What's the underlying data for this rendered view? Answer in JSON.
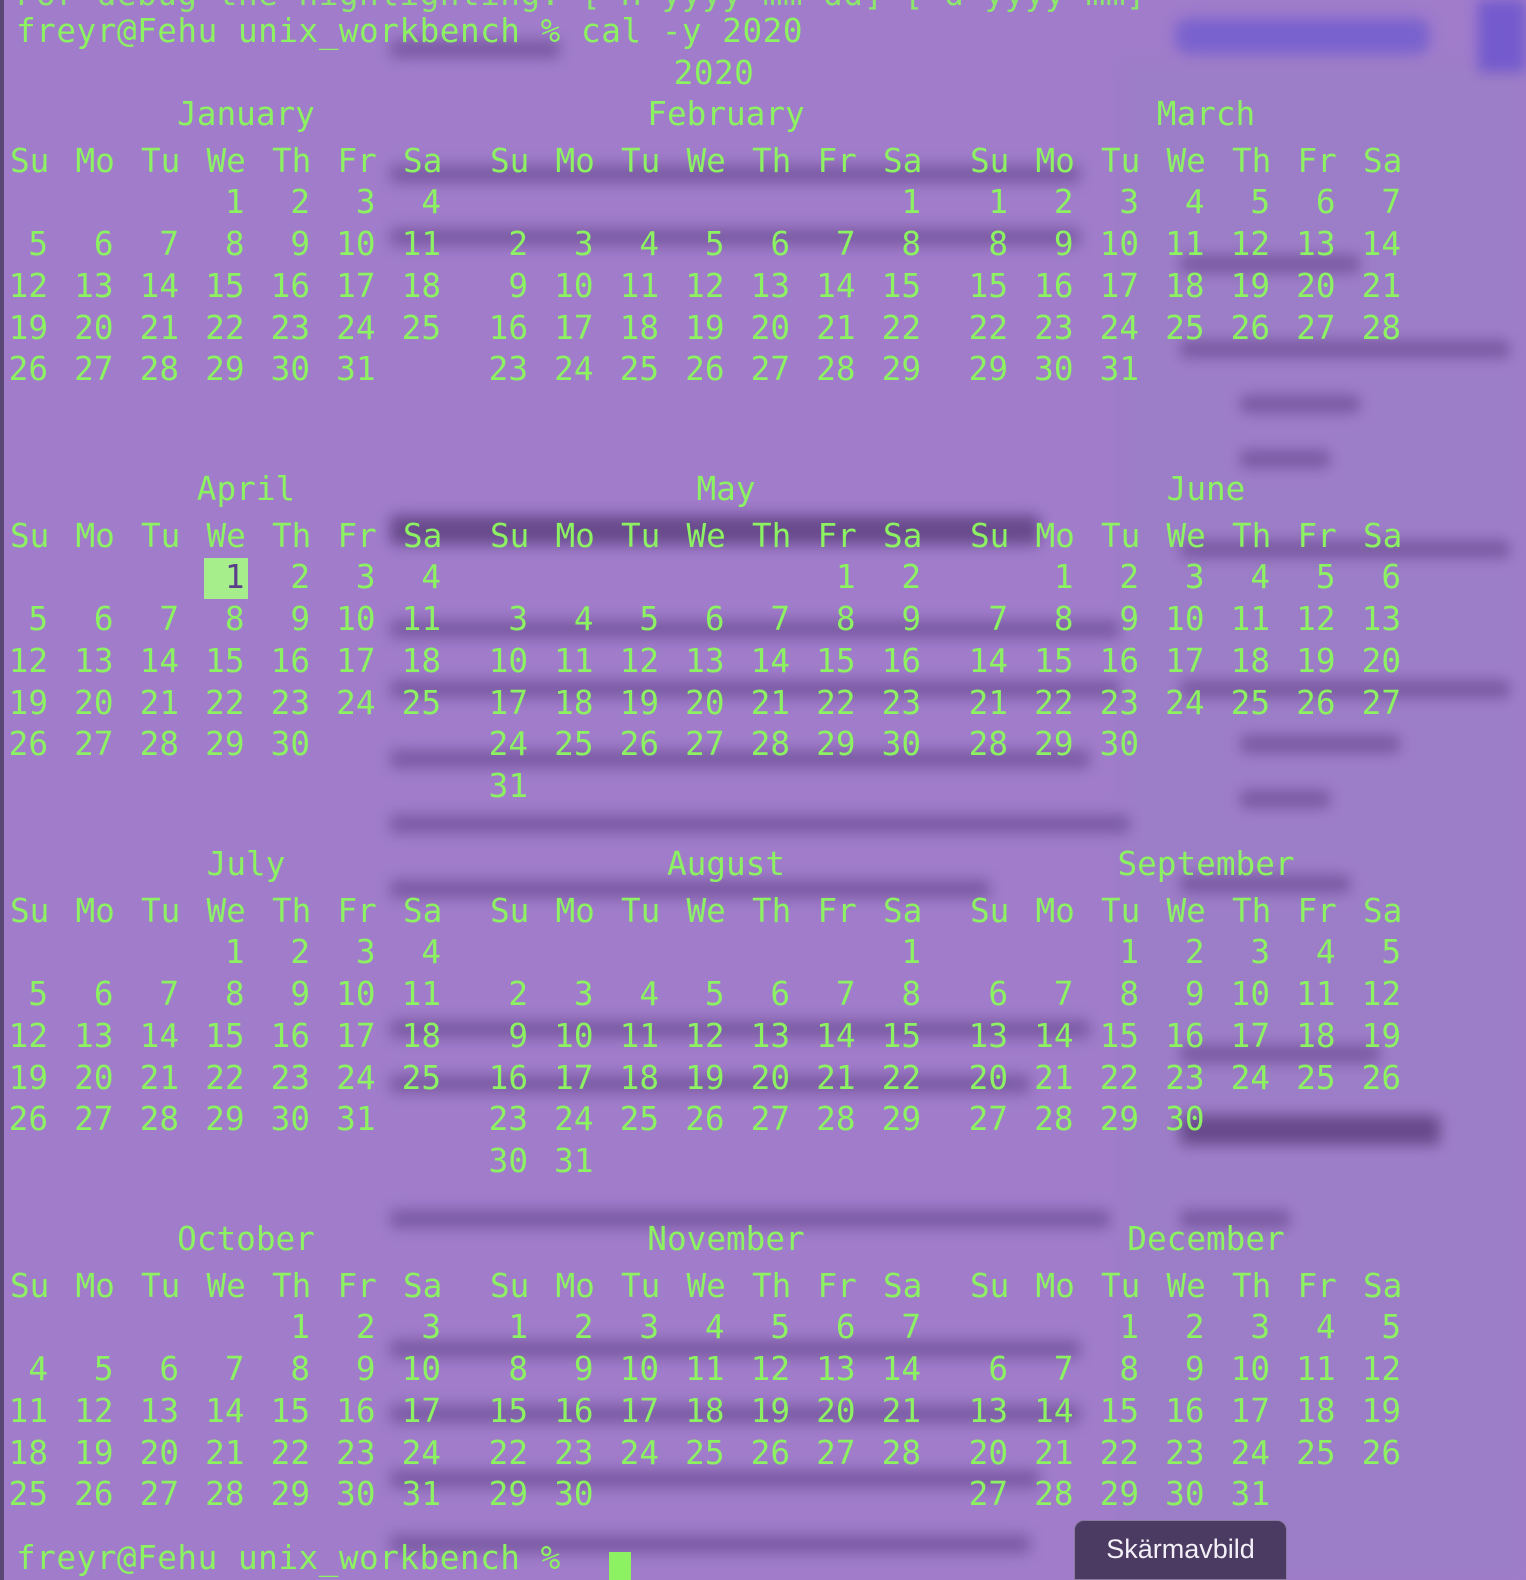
{
  "terminal": {
    "cut_line": "For debug the highlighting: [-H yyyy-mm-dd] [-d yyyy-mm]",
    "prompt_line": "freyr@Fehu unix_workbench % cal -y 2020",
    "year": "2020",
    "bottom_prompt": "freyr@Fehu unix_workbench % "
  },
  "calendar": {
    "weekday_headers": [
      "Su",
      "Mo",
      "Tu",
      "We",
      "Th",
      "Fr",
      "Sa"
    ],
    "highlighted": {
      "month": "April",
      "day": "1"
    },
    "months": [
      {
        "name": "January",
        "weeks": [
          [
            "",
            "",
            "",
            "1",
            "2",
            "3",
            "4"
          ],
          [
            "5",
            "6",
            "7",
            "8",
            "9",
            "10",
            "11"
          ],
          [
            "12",
            "13",
            "14",
            "15",
            "16",
            "17",
            "18"
          ],
          [
            "19",
            "20",
            "21",
            "22",
            "23",
            "24",
            "25"
          ],
          [
            "26",
            "27",
            "28",
            "29",
            "30",
            "31",
            ""
          ]
        ]
      },
      {
        "name": "February",
        "weeks": [
          [
            "",
            "",
            "",
            "",
            "",
            "",
            "1"
          ],
          [
            "2",
            "3",
            "4",
            "5",
            "6",
            "7",
            "8"
          ],
          [
            "9",
            "10",
            "11",
            "12",
            "13",
            "14",
            "15"
          ],
          [
            "16",
            "17",
            "18",
            "19",
            "20",
            "21",
            "22"
          ],
          [
            "23",
            "24",
            "25",
            "26",
            "27",
            "28",
            "29"
          ]
        ]
      },
      {
        "name": "March",
        "weeks": [
          [
            "1",
            "2",
            "3",
            "4",
            "5",
            "6",
            "7"
          ],
          [
            "8",
            "9",
            "10",
            "11",
            "12",
            "13",
            "14"
          ],
          [
            "15",
            "16",
            "17",
            "18",
            "19",
            "20",
            "21"
          ],
          [
            "22",
            "23",
            "24",
            "25",
            "26",
            "27",
            "28"
          ],
          [
            "29",
            "30",
            "31",
            "",
            "",
            "",
            ""
          ]
        ]
      },
      {
        "name": "April",
        "weeks": [
          [
            "",
            "",
            "",
            "1",
            "2",
            "3",
            "4"
          ],
          [
            "5",
            "6",
            "7",
            "8",
            "9",
            "10",
            "11"
          ],
          [
            "12",
            "13",
            "14",
            "15",
            "16",
            "17",
            "18"
          ],
          [
            "19",
            "20",
            "21",
            "22",
            "23",
            "24",
            "25"
          ],
          [
            "26",
            "27",
            "28",
            "29",
            "30",
            "",
            ""
          ]
        ]
      },
      {
        "name": "May",
        "weeks": [
          [
            "",
            "",
            "",
            "",
            "",
            "1",
            "2"
          ],
          [
            "3",
            "4",
            "5",
            "6",
            "7",
            "8",
            "9"
          ],
          [
            "10",
            "11",
            "12",
            "13",
            "14",
            "15",
            "16"
          ],
          [
            "17",
            "18",
            "19",
            "20",
            "21",
            "22",
            "23"
          ],
          [
            "24",
            "25",
            "26",
            "27",
            "28",
            "29",
            "30"
          ],
          [
            "31",
            "",
            "",
            "",
            "",
            "",
            ""
          ]
        ]
      },
      {
        "name": "June",
        "weeks": [
          [
            "",
            "1",
            "2",
            "3",
            "4",
            "5",
            "6"
          ],
          [
            "7",
            "8",
            "9",
            "10",
            "11",
            "12",
            "13"
          ],
          [
            "14",
            "15",
            "16",
            "17",
            "18",
            "19",
            "20"
          ],
          [
            "21",
            "22",
            "23",
            "24",
            "25",
            "26",
            "27"
          ],
          [
            "28",
            "29",
            "30",
            "",
            "",
            "",
            ""
          ]
        ]
      },
      {
        "name": "July",
        "weeks": [
          [
            "",
            "",
            "",
            "1",
            "2",
            "3",
            "4"
          ],
          [
            "5",
            "6",
            "7",
            "8",
            "9",
            "10",
            "11"
          ],
          [
            "12",
            "13",
            "14",
            "15",
            "16",
            "17",
            "18"
          ],
          [
            "19",
            "20",
            "21",
            "22",
            "23",
            "24",
            "25"
          ],
          [
            "26",
            "27",
            "28",
            "29",
            "30",
            "31",
            ""
          ]
        ]
      },
      {
        "name": "August",
        "weeks": [
          [
            "",
            "",
            "",
            "",
            "",
            "",
            "1"
          ],
          [
            "2",
            "3",
            "4",
            "5",
            "6",
            "7",
            "8"
          ],
          [
            "9",
            "10",
            "11",
            "12",
            "13",
            "14",
            "15"
          ],
          [
            "16",
            "17",
            "18",
            "19",
            "20",
            "21",
            "22"
          ],
          [
            "23",
            "24",
            "25",
            "26",
            "27",
            "28",
            "29"
          ],
          [
            "30",
            "31",
            "",
            "",
            "",
            "",
            ""
          ]
        ]
      },
      {
        "name": "September",
        "weeks": [
          [
            "",
            "",
            "1",
            "2",
            "3",
            "4",
            "5"
          ],
          [
            "6",
            "7",
            "8",
            "9",
            "10",
            "11",
            "12"
          ],
          [
            "13",
            "14",
            "15",
            "16",
            "17",
            "18",
            "19"
          ],
          [
            "20",
            "21",
            "22",
            "23",
            "24",
            "25",
            "26"
          ],
          [
            "27",
            "28",
            "29",
            "30",
            "",
            "",
            ""
          ]
        ]
      },
      {
        "name": "October",
        "weeks": [
          [
            "",
            "",
            "",
            "",
            "1",
            "2",
            "3"
          ],
          [
            "4",
            "5",
            "6",
            "7",
            "8",
            "9",
            "10"
          ],
          [
            "11",
            "12",
            "13",
            "14",
            "15",
            "16",
            "17"
          ],
          [
            "18",
            "19",
            "20",
            "21",
            "22",
            "23",
            "24"
          ],
          [
            "25",
            "26",
            "27",
            "28",
            "29",
            "30",
            "31"
          ]
        ]
      },
      {
        "name": "November",
        "weeks": [
          [
            "1",
            "2",
            "3",
            "4",
            "5",
            "6",
            "7"
          ],
          [
            "8",
            "9",
            "10",
            "11",
            "12",
            "13",
            "14"
          ],
          [
            "15",
            "16",
            "17",
            "18",
            "19",
            "20",
            "21"
          ],
          [
            "22",
            "23",
            "24",
            "25",
            "26",
            "27",
            "28"
          ],
          [
            "29",
            "30",
            "",
            "",
            "",
            "",
            ""
          ]
        ]
      },
      {
        "name": "December",
        "weeks": [
          [
            "",
            "",
            "1",
            "2",
            "3",
            "4",
            "5"
          ],
          [
            "6",
            "7",
            "8",
            "9",
            "10",
            "11",
            "12"
          ],
          [
            "13",
            "14",
            "15",
            "16",
            "17",
            "18",
            "19"
          ],
          [
            "20",
            "21",
            "22",
            "23",
            "24",
            "25",
            "26"
          ],
          [
            "27",
            "28",
            "29",
            "30",
            "31",
            "",
            ""
          ]
        ]
      }
    ]
  },
  "overlay": {
    "screenshot_label": "Skärmavbild"
  },
  "colors": {
    "terminal_text": "#8cf262",
    "background": "#a07ccb",
    "highlight_bg": "#a6ee8c",
    "highlight_text": "#5b3f8b"
  }
}
